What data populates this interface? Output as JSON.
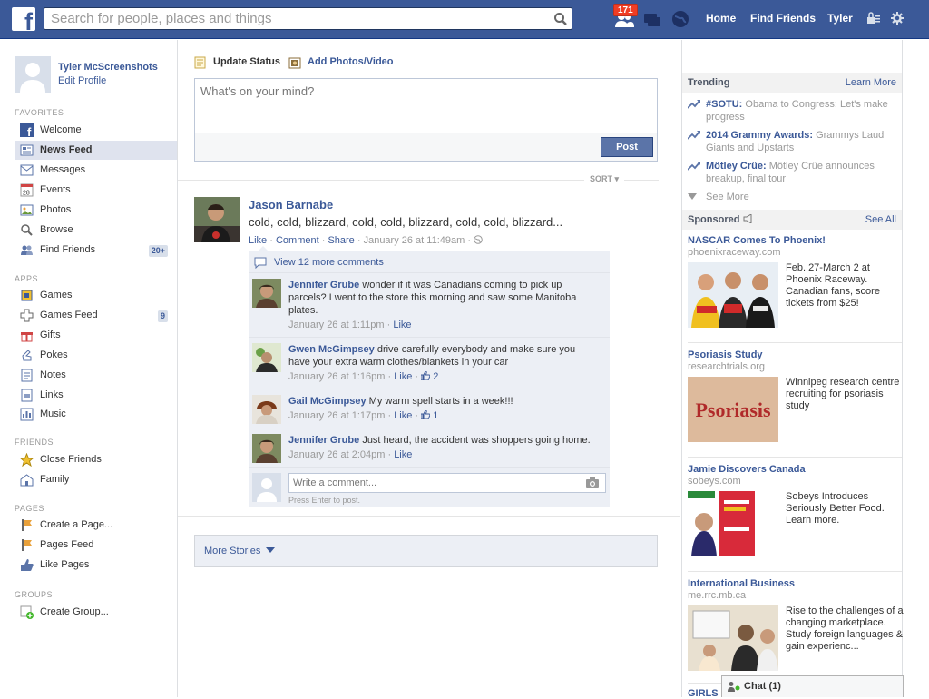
{
  "topbar": {
    "search_placeholder": "Search for people, places and things",
    "notifications_count": "171",
    "links": {
      "home": "Home",
      "find_friends": "Find Friends",
      "user": "Tyler"
    },
    "logo_letter": "f"
  },
  "profile": {
    "name": "Tyler McScreenshots",
    "edit": "Edit Profile"
  },
  "sidebar": {
    "favorites_header": "FAVORITES",
    "favorites": [
      {
        "label": "Welcome",
        "icon": "facebook-icon"
      },
      {
        "label": "News Feed",
        "icon": "newsfeed-icon",
        "selected": true
      },
      {
        "label": "Messages",
        "icon": "messages-icon"
      },
      {
        "label": "Events",
        "icon": "calendar-icon",
        "icon_text": "28"
      },
      {
        "label": "Photos",
        "icon": "photos-icon"
      },
      {
        "label": "Browse",
        "icon": "search-icon"
      },
      {
        "label": "Find Friends",
        "icon": "friends-icon",
        "count": "20+"
      }
    ],
    "apps_header": "APPS",
    "apps": [
      {
        "label": "Games",
        "icon": "games-icon"
      },
      {
        "label": "Games Feed",
        "icon": "games-feed-icon",
        "count": "9"
      },
      {
        "label": "Gifts",
        "icon": "gift-icon"
      },
      {
        "label": "Pokes",
        "icon": "poke-icon"
      },
      {
        "label": "Notes",
        "icon": "notes-icon"
      },
      {
        "label": "Links",
        "icon": "links-icon"
      },
      {
        "label": "Music",
        "icon": "music-icon"
      }
    ],
    "friends_header": "FRIENDS",
    "friends": [
      {
        "label": "Close Friends",
        "icon": "star-icon"
      },
      {
        "label": "Family",
        "icon": "family-icon"
      }
    ],
    "pages_header": "PAGES",
    "pages": [
      {
        "label": "Create a Page...",
        "icon": "create-page-icon"
      },
      {
        "label": "Pages Feed",
        "icon": "pages-feed-icon"
      },
      {
        "label": "Like Pages",
        "icon": "like-icon"
      }
    ],
    "groups_header": "GROUPS",
    "groups": [
      {
        "label": "Create Group...",
        "icon": "create-group-icon"
      }
    ]
  },
  "composer": {
    "tab_status": "Update Status",
    "tab_photos": "Add Photos/Video",
    "placeholder": "What's on your mind?",
    "post_label": "Post"
  },
  "feed": {
    "sort_label": "SORT ▾",
    "more_stories": "More Stories"
  },
  "story": {
    "author": "Jason Barnabe",
    "message": "cold, cold, blizzard, cold, cold, blizzard, cold, cold, blizzard...",
    "like": "Like",
    "comment": "Comment",
    "share": "Share",
    "time": "January 26 at 11:49am",
    "view_more": "View 12 more comments",
    "comments": [
      {
        "name": "Jennifer Grube",
        "text": "wonder if it was Canadians coming to pick up parcels? I went to the store this morning and saw some Manitoba plates.",
        "time": "January 26 at 1:11pm",
        "like": "Like",
        "likes": ""
      },
      {
        "name": "Gwen McGimpsey",
        "text": "drive carefully everybody and make sure you have your extra warm clothes/blankets in your car",
        "time": "January 26 at 1:16pm",
        "like": "Like",
        "likes": "2"
      },
      {
        "name": "Gail McGimpsey",
        "text": "My warm spell starts in a week!!!",
        "time": "January 26 at 1:17pm",
        "like": "Like",
        "likes": "1"
      },
      {
        "name": "Jennifer Grube",
        "text": "Just heard, the accident was shoppers going home.",
        "time": "January 26 at 2:04pm",
        "like": "Like",
        "likes": ""
      }
    ],
    "write_placeholder": "Write a comment...",
    "press_enter": "Press Enter to post."
  },
  "trending": {
    "header": "Trending",
    "learn_more": "Learn More",
    "items": [
      {
        "topic": "#SOTU:",
        "text": "Obama to Congress: Let's make progress"
      },
      {
        "topic": "2014 Grammy Awards:",
        "text": "Grammys Laud Giants and Upstarts"
      },
      {
        "topic": "Mötley Crüe:",
        "text": "Mötley Crüe announces breakup, final tour"
      }
    ],
    "see_more": "See More"
  },
  "sponsored": {
    "header": "Sponsored",
    "see_all": "See All",
    "ads": [
      {
        "title": "NASCAR Comes To Phoenix!",
        "site": "phoenixraceway.com",
        "text": "Feb. 27-March 2 at Phoenix Raceway. Canadian fans, score tickets from $25!"
      },
      {
        "title": "Psoriasis Study",
        "site": "researchtrials.org",
        "text": "Winnipeg research centre recruiting for psoriasis study",
        "image_text": "Psoriasis"
      },
      {
        "title": "Jamie Discovers Canada",
        "site": "sobeys.com",
        "text": "Sobeys Introduces Seriously Better Food. Learn more."
      },
      {
        "title": "International Business",
        "site": "me.rrc.mb.ca",
        "text": "Rise to the challenges of a changing marketplace. Study foreign languages & gain experienc..."
      },
      {
        "title": "GIRLS S",
        "site": "",
        "text": ""
      }
    ]
  },
  "chat": {
    "label": "Chat (1)"
  },
  "colors": {
    "brand": "#3b5998",
    "badge": "#f03d25",
    "link": "#3b5998"
  }
}
